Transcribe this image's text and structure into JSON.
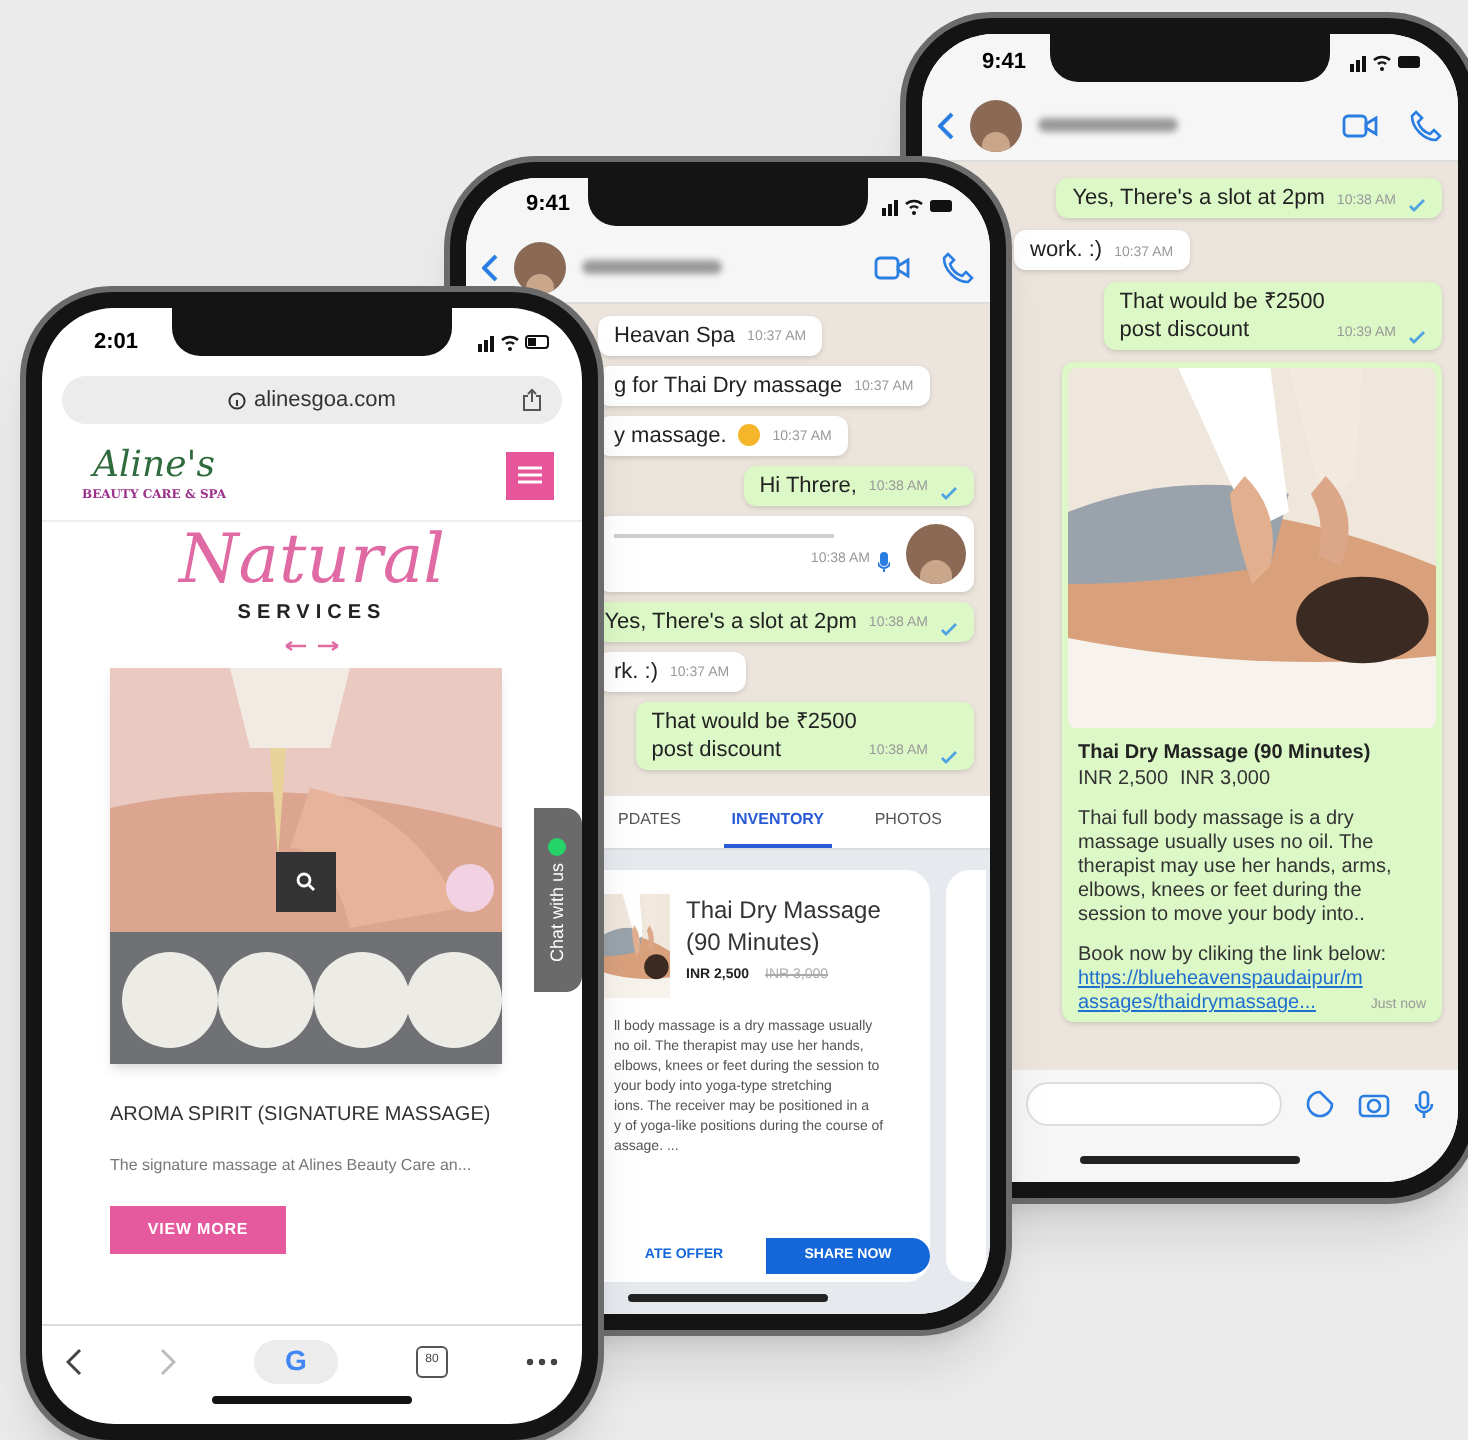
{
  "browser_phone": {
    "time": "2:01",
    "url": "alinesgoa.com",
    "logo": {
      "title": "Aline's",
      "subtitle": "BEAUTY CARE & SPA"
    },
    "heading_script": "Natural",
    "heading": "SERVICES",
    "chat_tab": "Chat with us",
    "service": {
      "title": "AROMA SPIRIT (SIGNATURE MASSAGE)",
      "excerpt": "The signature massage at Alines Beauty Care an...",
      "button": "VIEW MORE"
    },
    "toolbar": {
      "search_logo": "G",
      "tab_count": "80"
    }
  },
  "chat_phone_middle": {
    "time": "9:41",
    "messages": [
      {
        "kind": "text",
        "outgoing": false,
        "text": "Heavan Spa",
        "time": "10:37 AM"
      },
      {
        "kind": "text",
        "outgoing": false,
        "text": "g for Thai Dry massage",
        "time": "10:37 AM"
      },
      {
        "kind": "text",
        "outgoing": false,
        "text": "y massage.",
        "emoji": true,
        "time": "10:37 AM"
      },
      {
        "kind": "text",
        "outgoing": true,
        "text": "Hi Threre,",
        "time": "10:38 AM"
      },
      {
        "kind": "voice",
        "time": "10:38 AM"
      },
      {
        "kind": "text",
        "outgoing": true,
        "text": "Yes, There's a slot at 2pm",
        "time": "10:38 AM"
      },
      {
        "kind": "text",
        "outgoing": false,
        "text": "rk. :)",
        "time": "10:37 AM"
      },
      {
        "kind": "text",
        "outgoing": true,
        "text": "That would be ₹2500\npost discount",
        "time": "10:38 AM"
      }
    ],
    "tabs": [
      {
        "label": "PDATES",
        "selected": false
      },
      {
        "label": "INVENTORY",
        "selected": true
      },
      {
        "label": "PHOTOS",
        "selected": false
      }
    ],
    "product": {
      "title": "Thai Dry Massage (90 Minutes)",
      "price": "INR 2,500",
      "old_price": "INR 3,000",
      "description_lines": [
        "ll body massage is a dry massage usually",
        "no oil. The therapist may use her hands,",
        "elbows, knees or feet during the session to",
        "your body into yoga-type stretching",
        "ions. The receiver may be positioned in a",
        "y of yoga-like positions during the course of",
        "assage. ..."
      ],
      "actions": [
        {
          "label": "ATE OFFER",
          "primary": false
        },
        {
          "label": "SHARE NOW",
          "primary": true
        }
      ]
    }
  },
  "chat_phone_back": {
    "time": "9:41",
    "messages": [
      {
        "kind": "text",
        "outgoing": true,
        "text": "Yes, There's a slot at 2pm",
        "time": "10:38 AM"
      },
      {
        "kind": "text",
        "outgoing": false,
        "text": "work. :)",
        "time": "10:37 AM"
      },
      {
        "kind": "text",
        "outgoing": true,
        "text": "That would be ₹2500\npost discount",
        "time": "10:39 AM"
      },
      {
        "kind": "product",
        "outgoing": true,
        "title": "Thai Dry Massage (90 Minutes)",
        "price": "INR 2,500",
        "old_price": "INR 3,000",
        "body": "Thai full body massage is a dry massage usually uses no oil. The therapist may use her hands, arms, elbows, knees or feet during the session to move your body into..",
        "cta": "Book now by cliking the link below:",
        "link": "https://blueheavenspaudaipur/massages/thaidrymassage...",
        "time": "Just now"
      }
    ]
  }
}
